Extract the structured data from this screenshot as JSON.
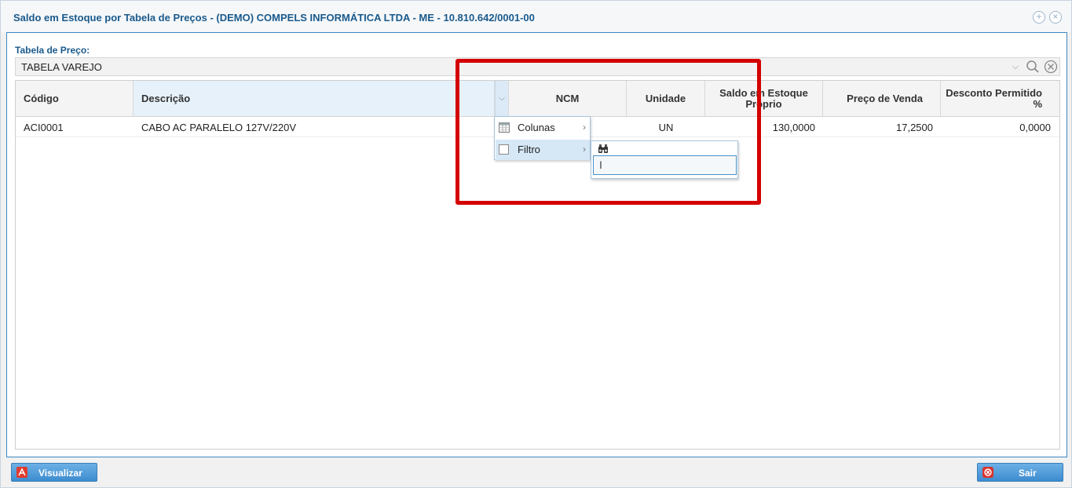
{
  "window": {
    "title": "Saldo em Estoque por Tabela de Preços - (DEMO) COMPELS INFORMÁTICA LTDA - ME - 10.810.642/0001-00"
  },
  "filter": {
    "label": "Tabela de Preço:",
    "value": "TABELA VAREJO"
  },
  "grid": {
    "columns": [
      {
        "label": "Código"
      },
      {
        "label": "Descrição"
      },
      {
        "label": "NCM"
      },
      {
        "label": "Unidade"
      },
      {
        "label": "Saldo em Estoque Próprio"
      },
      {
        "label": "Preço de Venda"
      },
      {
        "label": "Desconto Permitido %"
      }
    ],
    "rows": [
      {
        "codigo": "ACI0001",
        "descricao": "CABO AC PARALELO 127V/220V",
        "ncm": "",
        "unidade": "UN",
        "saldo": "130,0000",
        "preco": "17,2500",
        "desconto": "0,0000"
      }
    ]
  },
  "column_menu": {
    "items": [
      {
        "label": "Colunas"
      },
      {
        "label": "Filtro"
      }
    ],
    "filter_input_value": ""
  },
  "footer": {
    "visualizar_label": "Visualizar",
    "sair_label": "Sair"
  },
  "colors": {
    "accent": "#3d8ccf",
    "title_text": "#1a5a8c",
    "highlight": "#d40000"
  },
  "icons": {
    "expand": "plus-circle-icon",
    "close": "close-circle-icon",
    "pdf": "pdf-icon",
    "exit": "exit-icon"
  }
}
